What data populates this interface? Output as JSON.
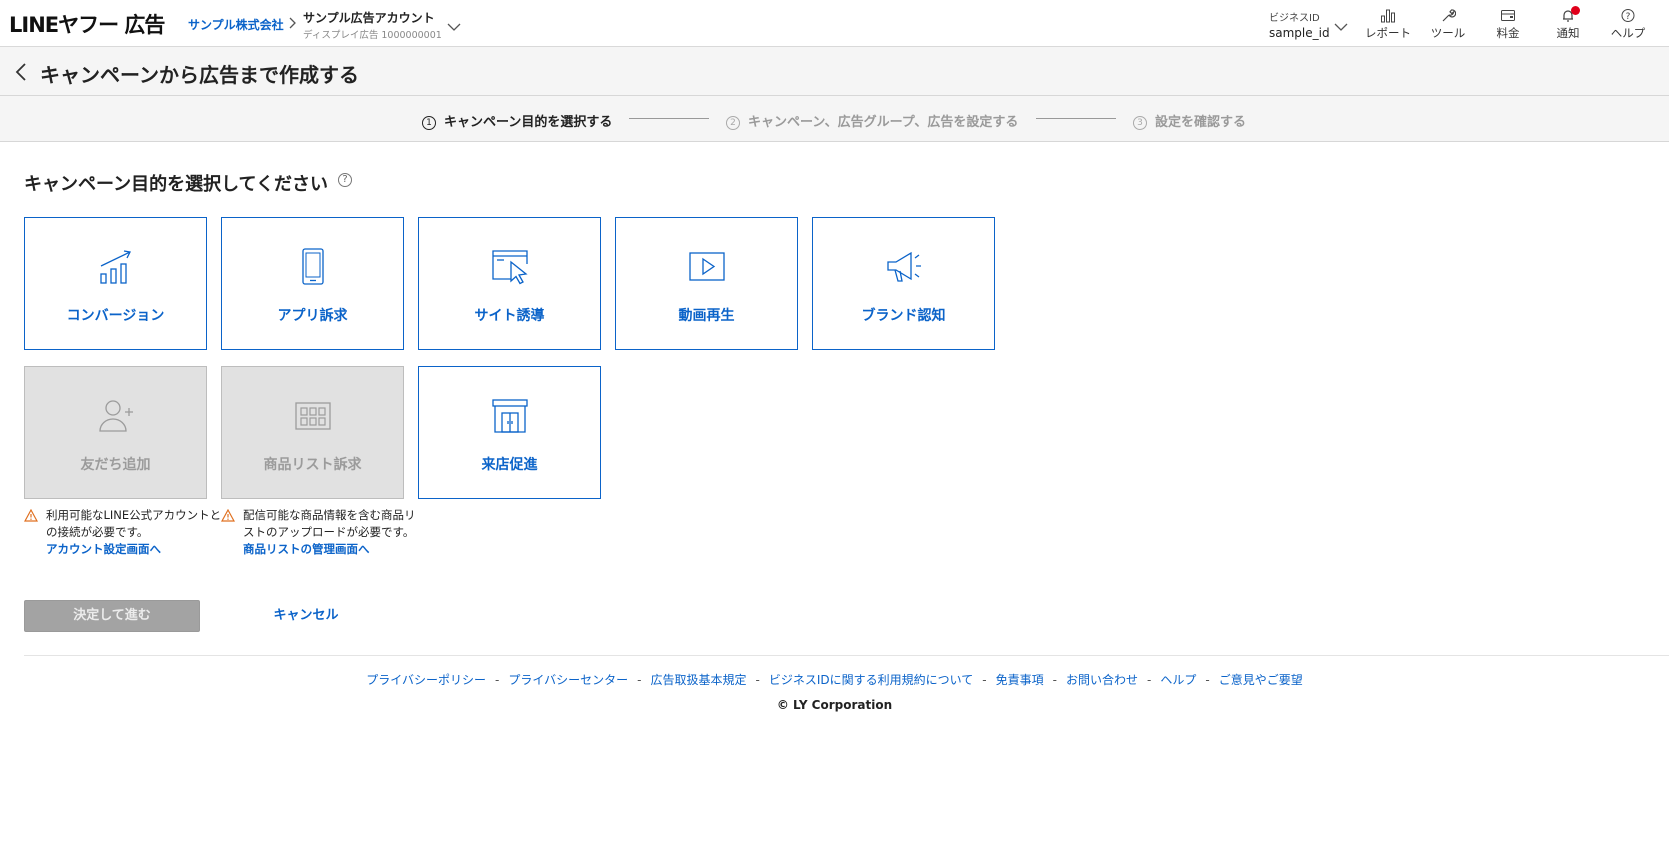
{
  "header": {
    "logo_text": "LINEヤフー 広告",
    "company_link": "サンプル株式会社",
    "account_name": "サンプル広告アカウント",
    "account_sub": "ディスプレイ広告 1000000001",
    "business_id_label": "ビジネスID",
    "business_id_value": "sample_id",
    "nav": {
      "report": "レポート",
      "tool": "ツール",
      "billing": "料金",
      "notification": "通知",
      "help": "ヘルプ"
    }
  },
  "page": {
    "title": "キャンペーンから広告まで作成する"
  },
  "stepper": {
    "steps": [
      {
        "num": "1",
        "label": "キャンペーン目的を選択する",
        "state": "active"
      },
      {
        "num": "2",
        "label": "キャンペーン、広告グループ、広告を設定する",
        "state": "inactive"
      },
      {
        "num": "3",
        "label": "設定を確認する",
        "state": "inactive"
      }
    ]
  },
  "main": {
    "section_title": "キャンペーン目的を選択してください",
    "help_glyph": "?",
    "objectives": [
      {
        "label": "コンバージョン",
        "icon": "chart-growth-icon",
        "enabled": true
      },
      {
        "label": "アプリ訴求",
        "icon": "smartphone-icon",
        "enabled": true
      },
      {
        "label": "サイト誘導",
        "icon": "browser-cursor-icon",
        "enabled": true
      },
      {
        "label": "動画再生",
        "icon": "video-play-icon",
        "enabled": true
      },
      {
        "label": "ブランド認知",
        "icon": "megaphone-icon",
        "enabled": true
      },
      {
        "label": "友だち追加",
        "icon": "add-friend-icon",
        "enabled": false
      },
      {
        "label": "商品リスト訴求",
        "icon": "product-list-icon",
        "enabled": false
      },
      {
        "label": "来店促進",
        "icon": "storefront-icon",
        "enabled": true
      }
    ],
    "notices": {
      "friend_add": {
        "text": "利用可能なLINE公式アカウントとの接続が必要です。",
        "link": "アカウント設定画面へ"
      },
      "product_list": {
        "text": "配信可能な商品情報を含む商品リストのアップロードが必要です。",
        "link": "商品リストの管理画面へ"
      }
    },
    "buttons": {
      "submit": "決定して進む",
      "cancel": "キャンセル"
    }
  },
  "footer": {
    "links": [
      "プライバシーポリシー",
      "プライバシーセンター",
      "広告取扱基本規定",
      "ビジネスIDに関する利用規約について",
      "免責事項",
      "お問い合わせ",
      "ヘルプ",
      "ご意見やご要望"
    ],
    "separator": "-",
    "copyright": "© LY Corporation"
  },
  "colors": {
    "accent": "#0b63c9",
    "notification_dot": "#e0001b",
    "warning": "#e07020",
    "disabled_card_bg": "#e1e1e1"
  }
}
